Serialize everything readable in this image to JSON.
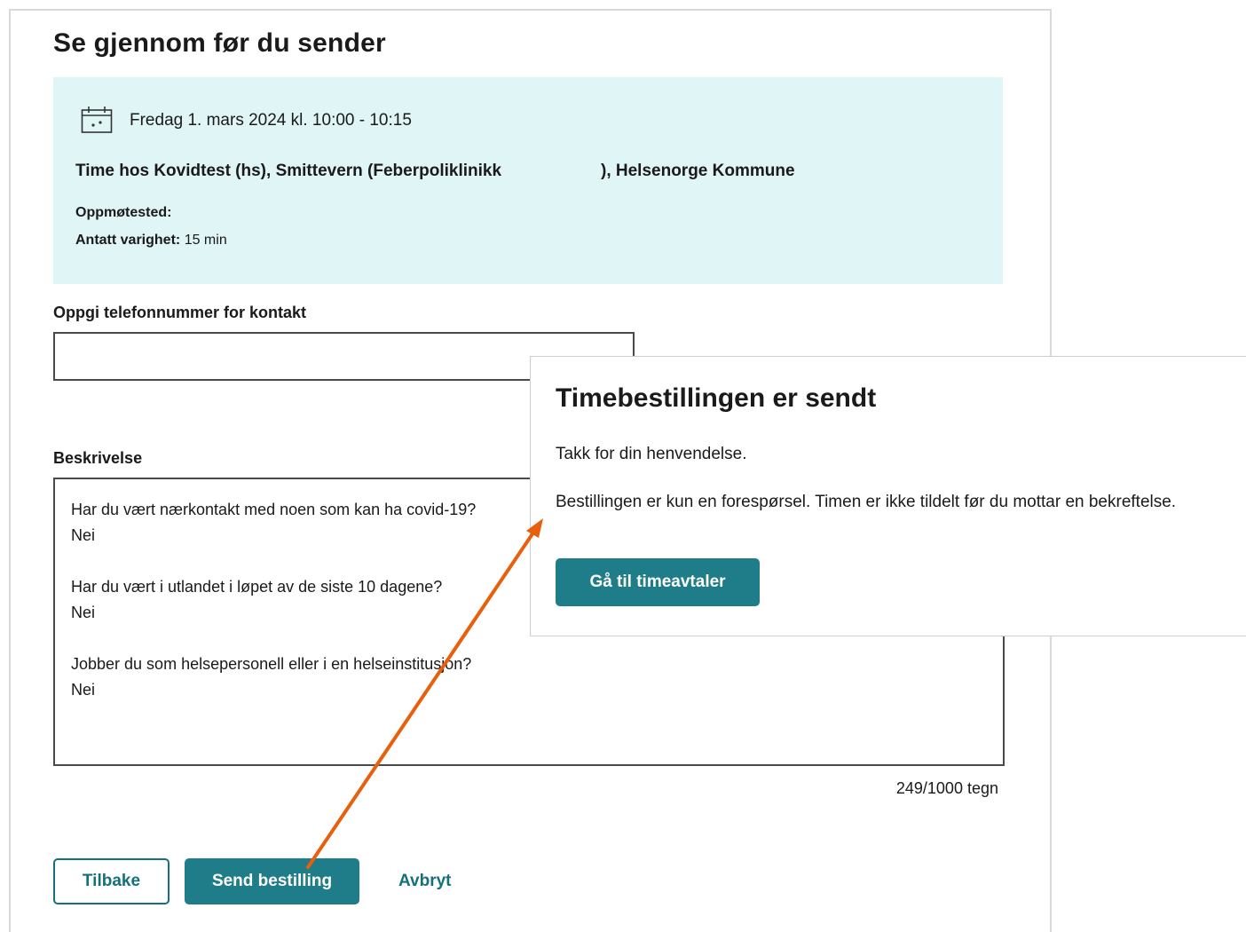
{
  "review": {
    "title": "Se gjennom før du sender",
    "appointment": {
      "date": "Fredag 1. mars 2024 kl. 10:00 - 10:15",
      "place": "Time hos Kovidtest (hs), Smittevern (Feberpoliklinikk",
      "organization": "), Helsenorge Kommune",
      "meeting_place_label": "Oppmøtested:",
      "duration_label": "Antatt varighet:",
      "duration_value": "15 min",
      "icon": "calendar-icon"
    },
    "phone": {
      "label": "Oppgi telefonnummer for kontakt",
      "value": ""
    },
    "description": {
      "label": "Beskrivelse",
      "items": [
        {
          "question": "Har du vært nærkontakt med noen som kan ha covid-19?",
          "answer": "Nei"
        },
        {
          "question": "Har du vært i utlandet i løpet av de siste 10 dagene?",
          "answer": "Nei"
        },
        {
          "question": "Jobber du som helsepersonell eller i en helseinstitusjon?",
          "answer": "Nei"
        }
      ],
      "char_count": "249/1000 tegn"
    },
    "actions": {
      "back_label": "Tilbake",
      "send_label": "Send bestilling",
      "cancel_label": "Avbryt"
    }
  },
  "confirmation": {
    "title": "Timebestillingen er sendt",
    "thanks": "Takk for din henvendelse.",
    "note": "Bestillingen er kun en forespørsel. Timen er ikke tildelt før du mottar en bekreftelse.",
    "button_label": "Gå til timeavtaler"
  },
  "colors": {
    "accent": "#1f7d8a",
    "info_bg": "#e0f5f6",
    "annotation_arrow": "#e8600c"
  }
}
